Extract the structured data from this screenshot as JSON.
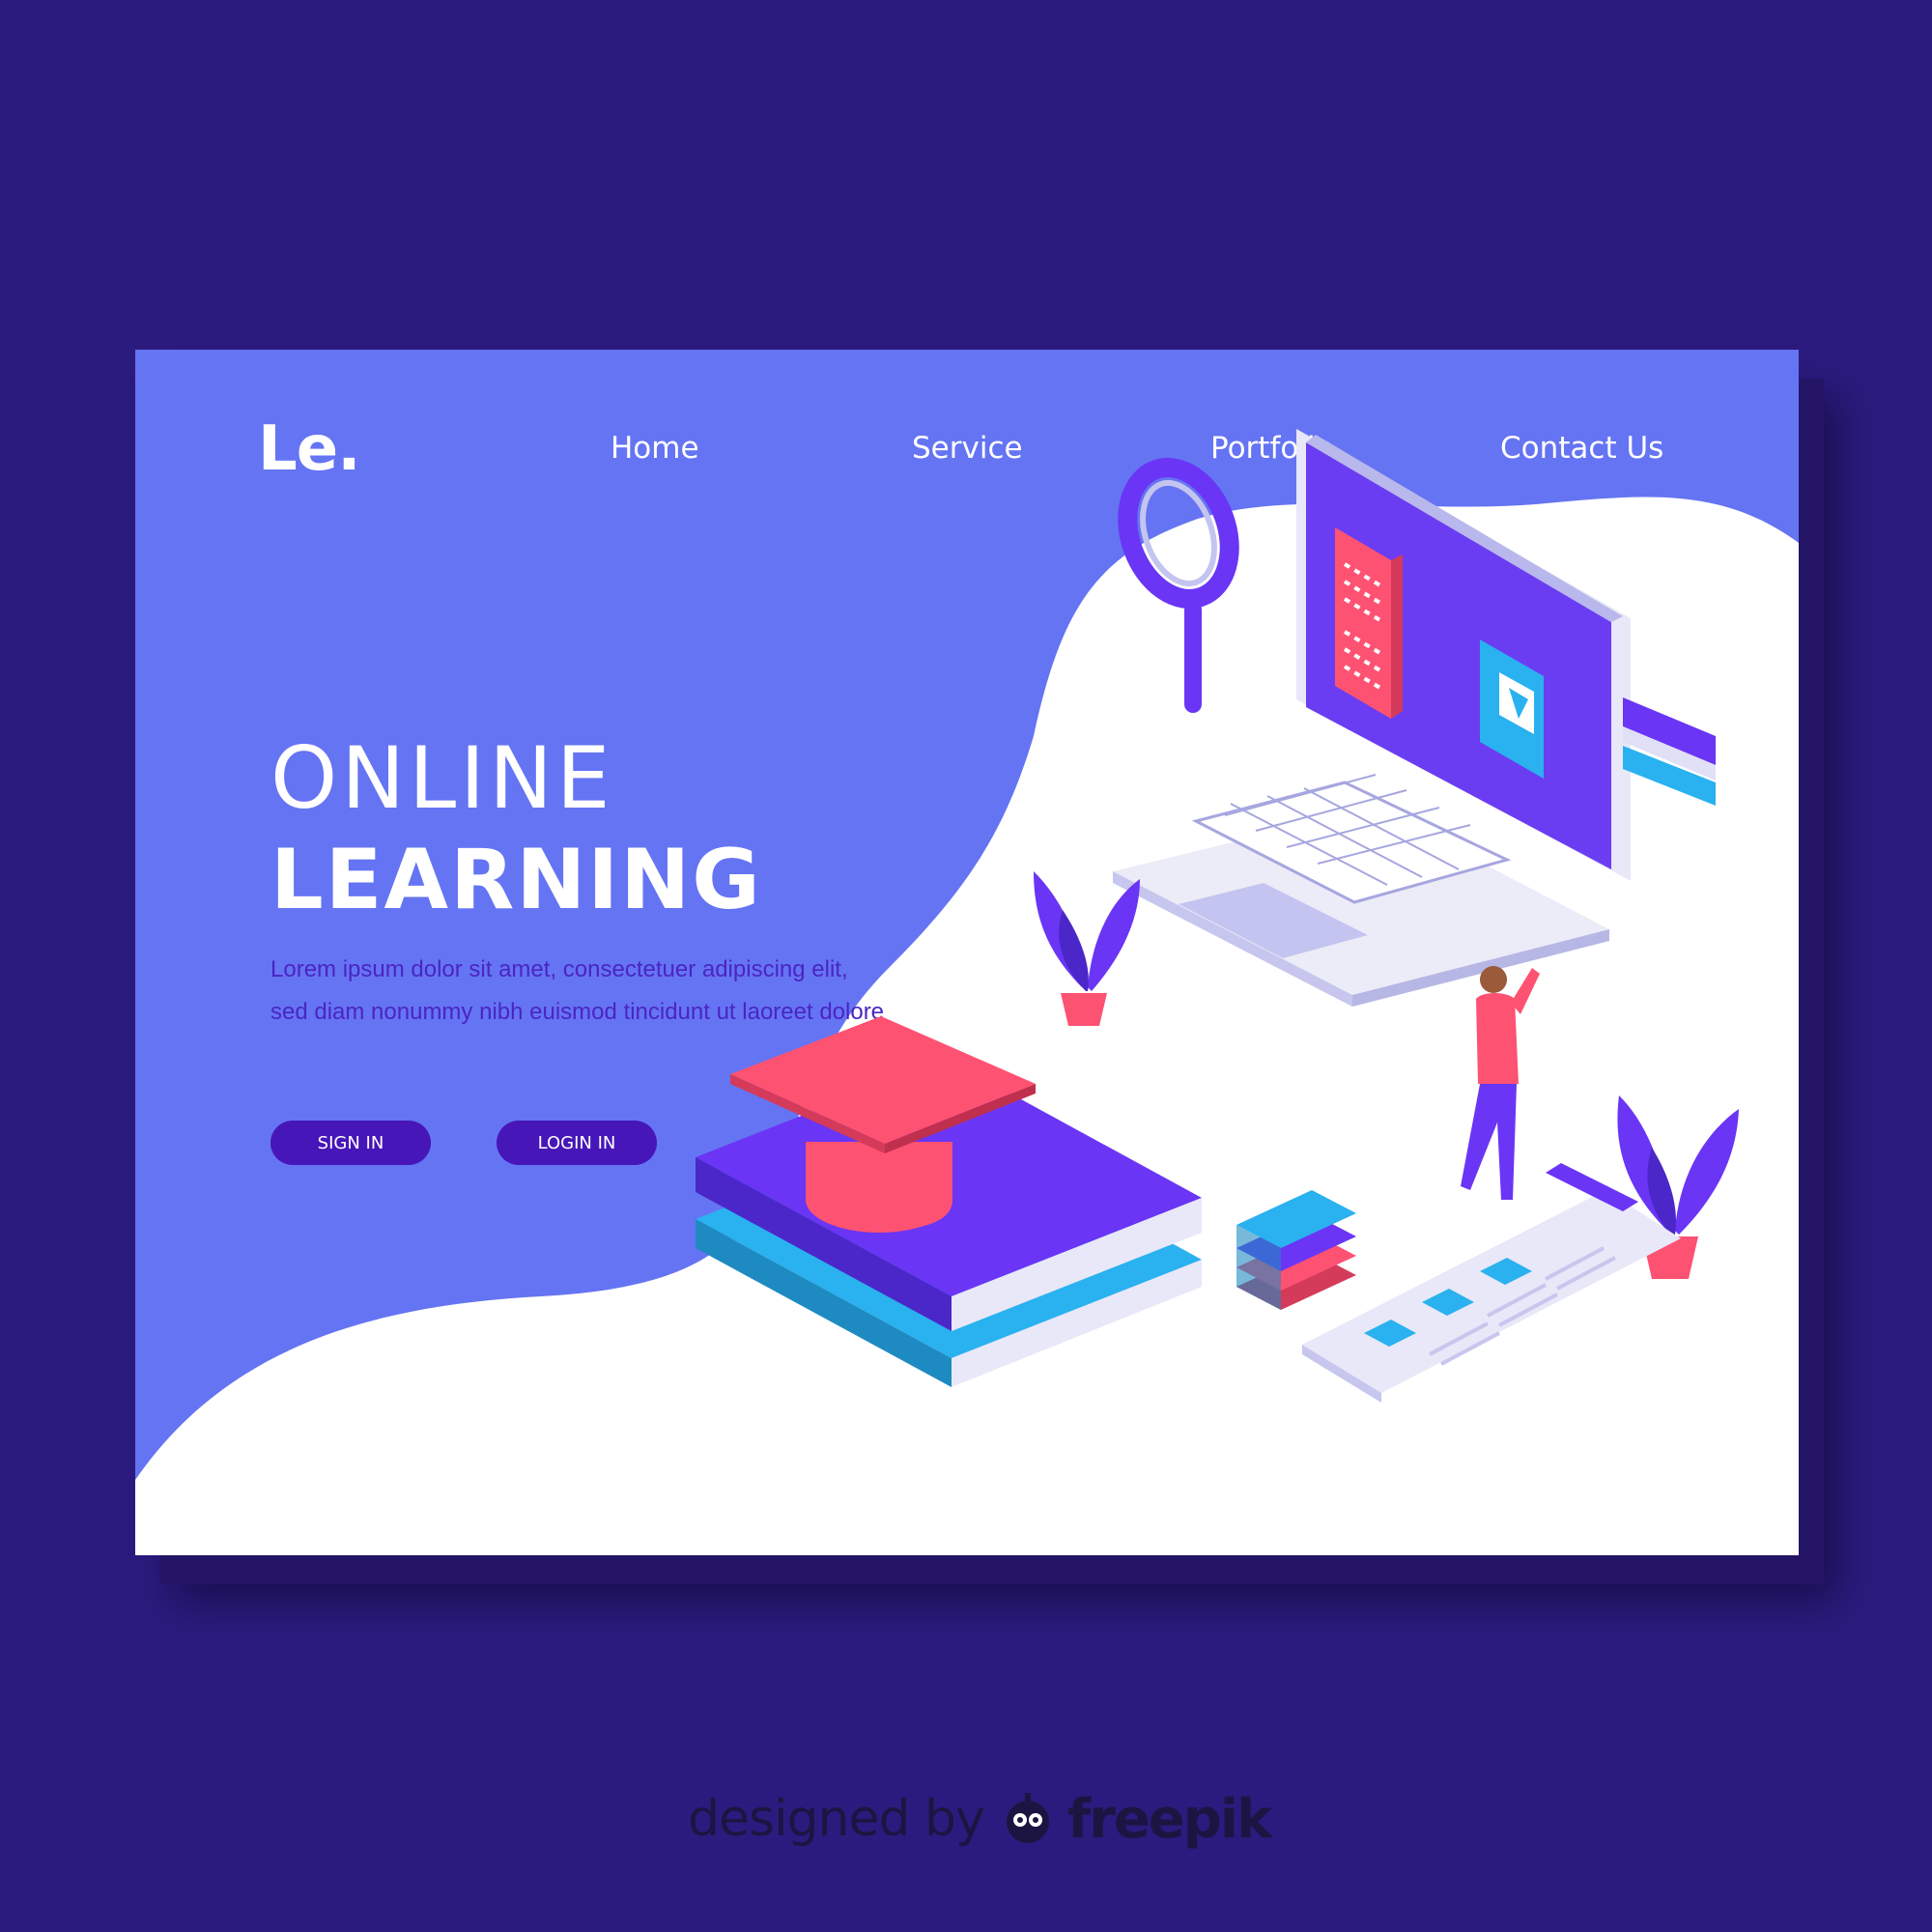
{
  "brand": {
    "logo": "Le."
  },
  "nav": {
    "items": [
      {
        "label": "Home"
      },
      {
        "label": "Service"
      },
      {
        "label": "Portfolio"
      },
      {
        "label": "Contact Us"
      }
    ]
  },
  "hero": {
    "title_line1": "ONLINE",
    "title_line2": "LEARNING",
    "description": "Lorem ipsum dolor sit amet, consectetuer adipiscing elit, sed diam nonummy nibh euismod tincidunt ut laoreet dolore",
    "sign_in_label": "SIGN IN",
    "login_in_label": "LOGIN IN"
  },
  "credit": {
    "text": "designed by",
    "brand": "freepik"
  },
  "colors": {
    "page_background": "#2c1b7e",
    "hero_background": "#6574f3",
    "button": "#4616b8",
    "accent_red": "#fe5272",
    "accent_blue": "#2ab1ef",
    "accent_purple": "#6a35f5"
  }
}
